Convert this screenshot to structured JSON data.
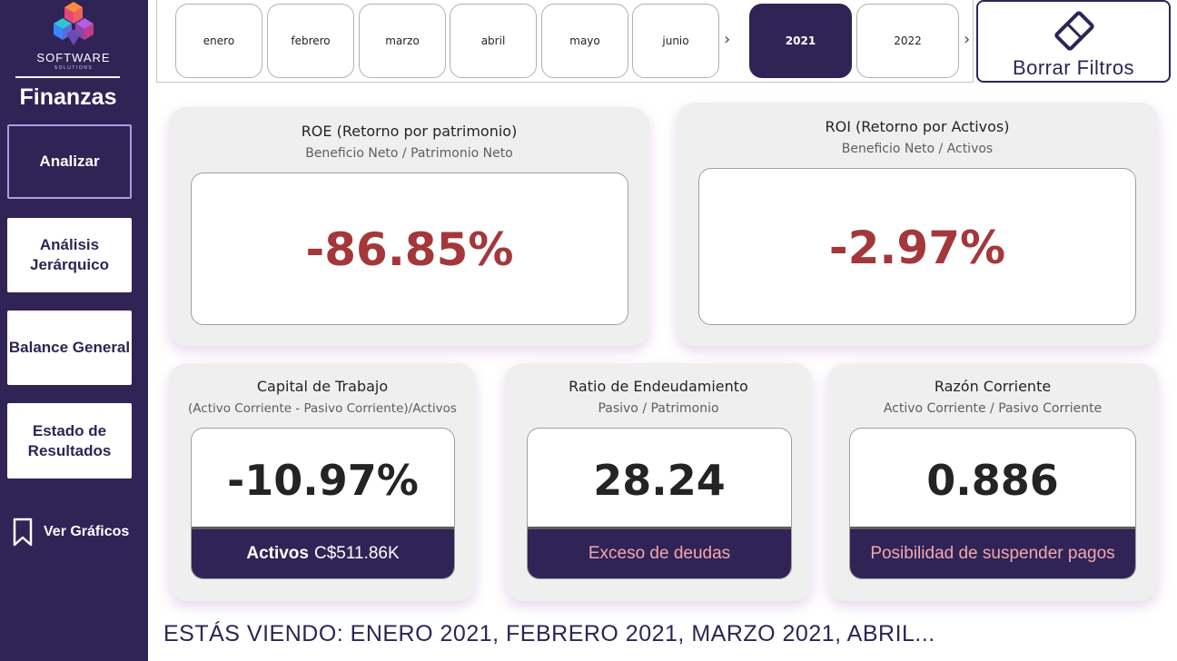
{
  "sidebar": {
    "logo_text": "SOFTWARE",
    "logo_sub": "SOLUTIONS",
    "title": "Finanzas",
    "nav": [
      {
        "label": "Analizar"
      },
      {
        "label": "Análisis Jerárquico"
      },
      {
        "label": "Balance General"
      },
      {
        "label": "Estado de Resultados"
      }
    ],
    "ver_graficos": "Ver Gráficos",
    "colors": {
      "background": "#2f2455",
      "active_border": "#a99ee0"
    }
  },
  "slicer": {
    "months": [
      "enero",
      "febrero",
      "marzo",
      "abril",
      "mayo",
      "junio"
    ],
    "years": [
      "2021",
      "2022"
    ],
    "selected_year": "2021",
    "chevron": "›",
    "clear_filters": "Borrar Filtros"
  },
  "kpis": {
    "roe": {
      "title": "ROE (Retorno por patrimonio)",
      "subtitle": "Beneficio Neto / Patrimonio Neto",
      "value": "-86.85%"
    },
    "roi": {
      "title": "ROI (Retorno por Activos)",
      "subtitle": "Beneficio Neto / Activos",
      "value": "-2.97%"
    },
    "capital": {
      "title": "Capital de Trabajo",
      "subtitle": "(Activo Corriente - Pasivo Corriente)/Activos",
      "value": "-10.97%",
      "footer_label": "Activos",
      "footer_value": "C$511.86K"
    },
    "endeudamiento": {
      "title": "Ratio de Endeudamiento",
      "subtitle": "Pasivo / Patrimonio",
      "value": "28.24",
      "footer": "Exceso de deudas"
    },
    "corriente": {
      "title": "Razón Corriente",
      "subtitle": "Activo Corriente / Pasivo Corriente",
      "value": "0.886",
      "footer": "Posibilidad de suspender pagos"
    }
  },
  "status_line": "ESTÁS VIENDO: ENERO 2021, FEBRERO 2021, MARZO 2021, ABRIL...",
  "colors": {
    "accent": "#2f2455",
    "negative": "#a4373a",
    "warning_text": "#f4a6b0",
    "card_bg": "#f0efef"
  }
}
